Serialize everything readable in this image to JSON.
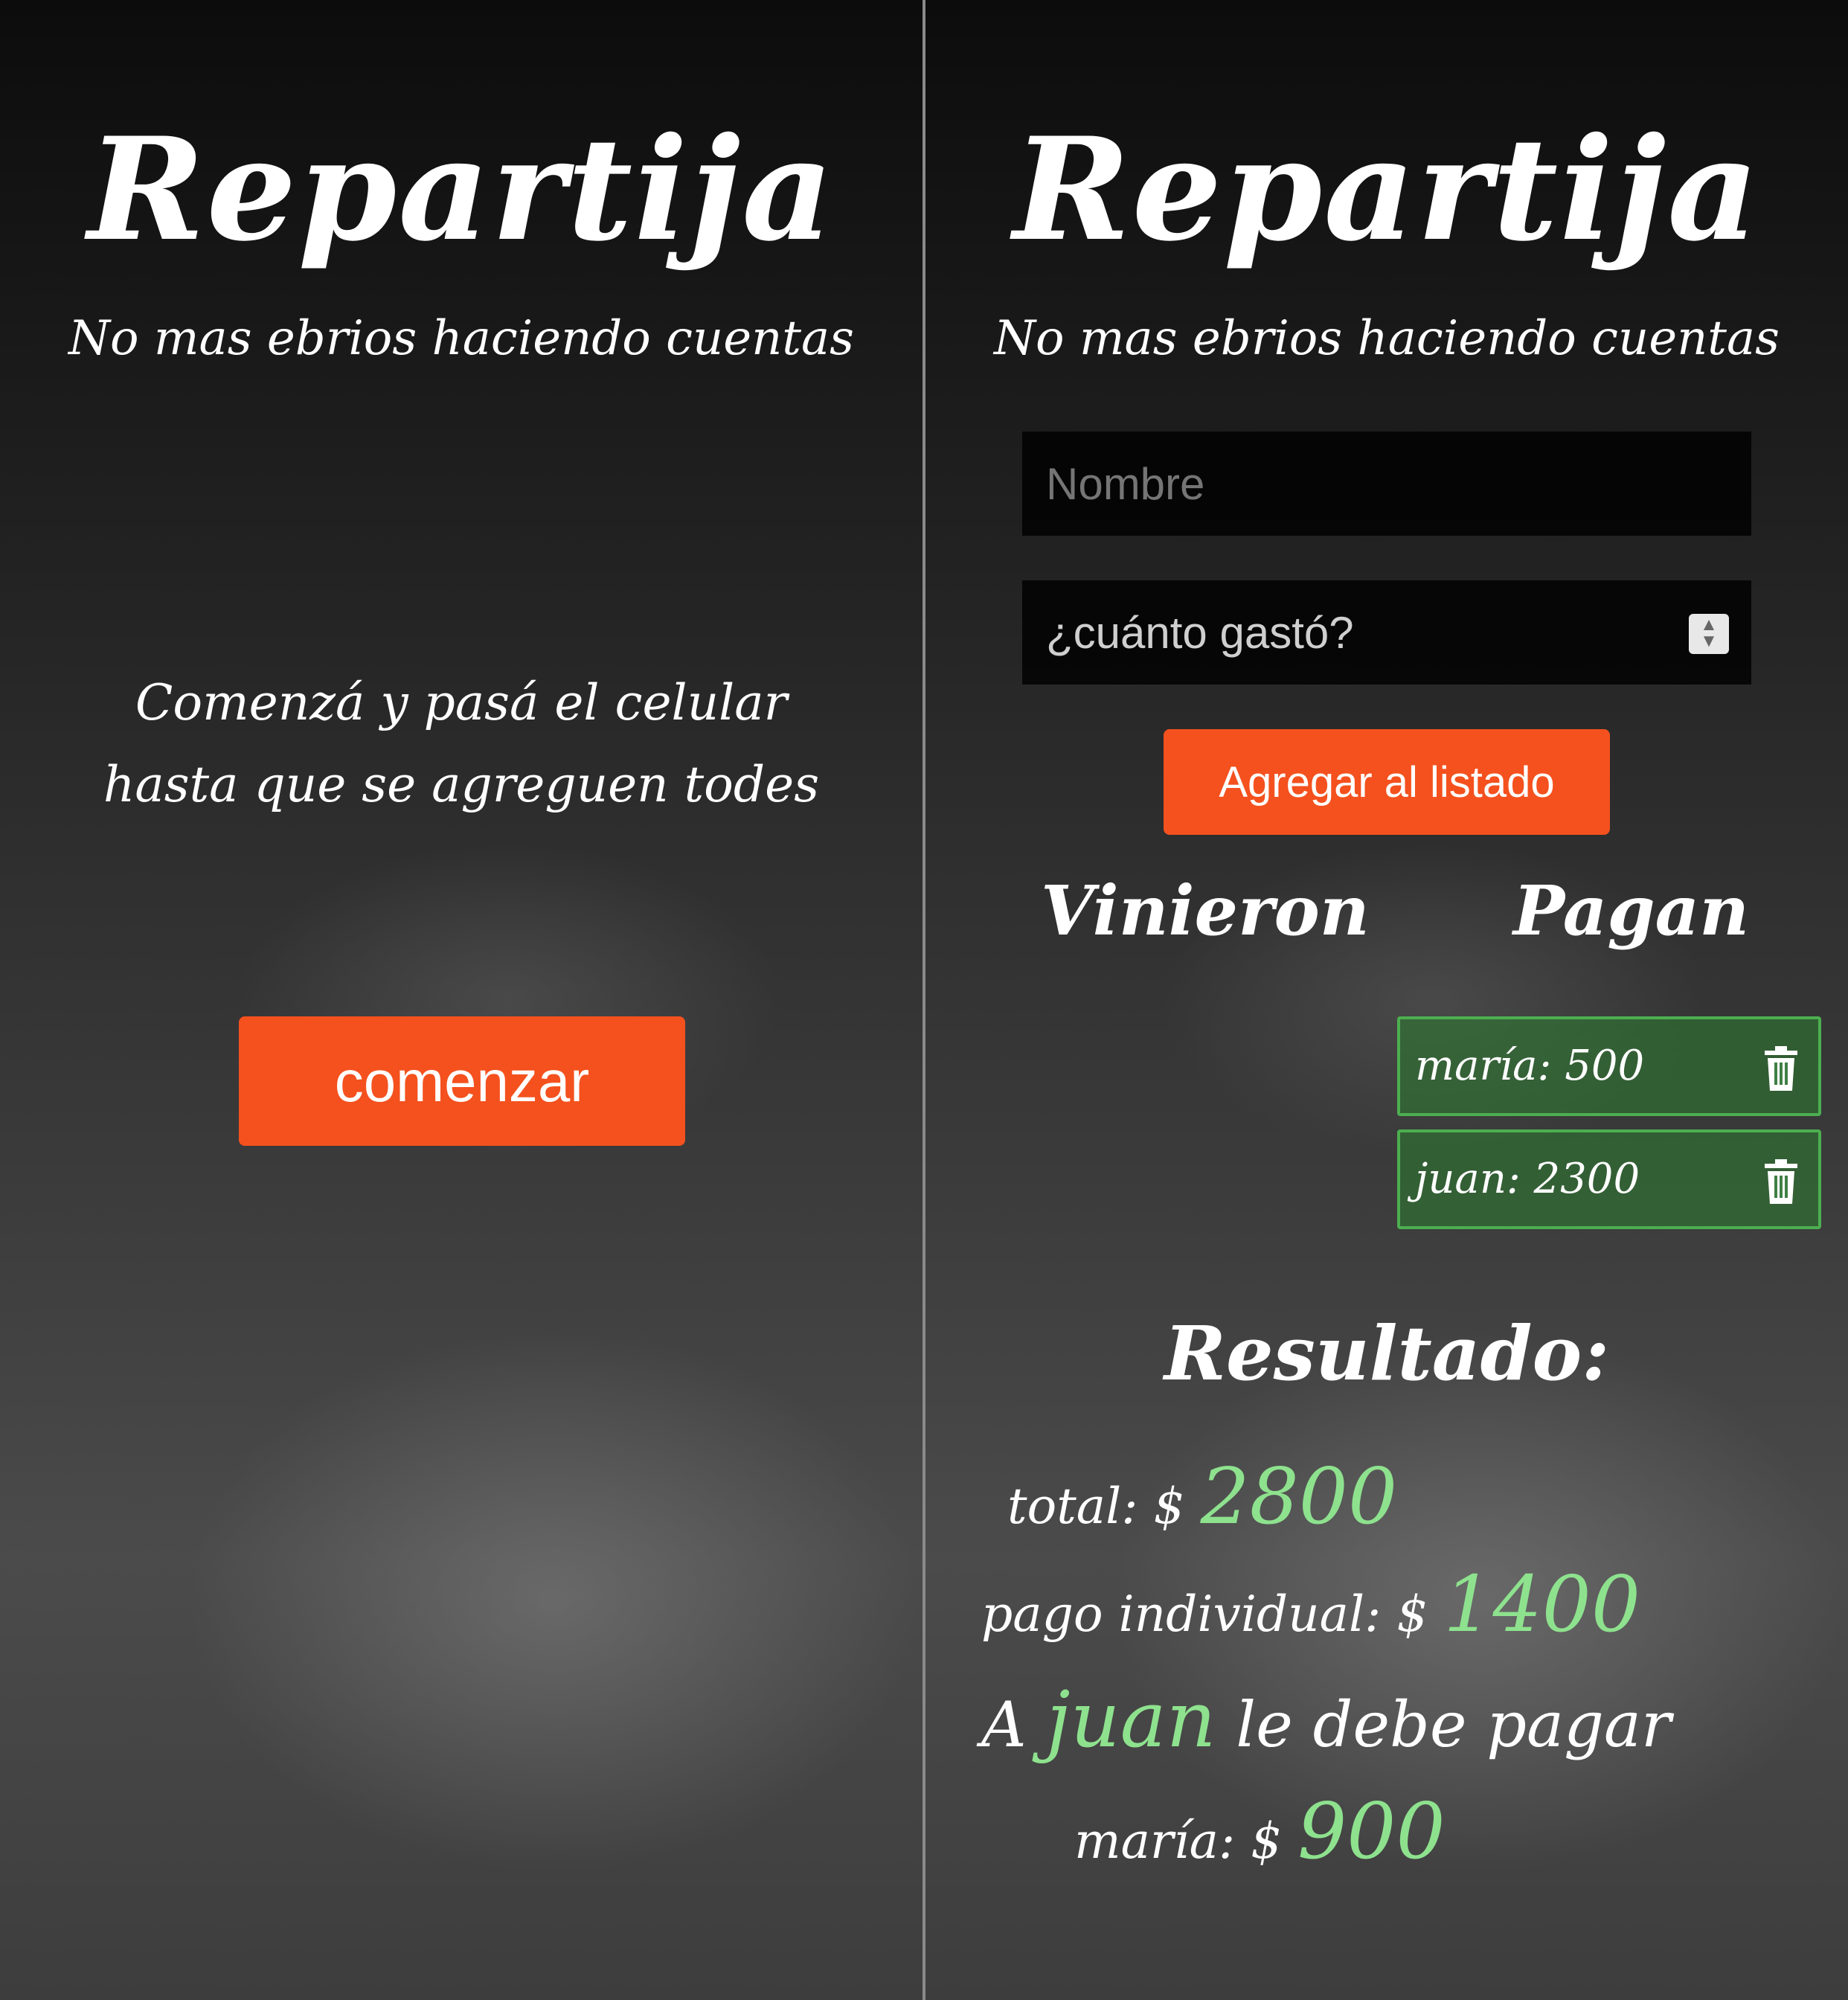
{
  "colors": {
    "accent_button": "#f4511e",
    "payer_item_bg": "#2e7d32",
    "payer_item_border": "#4caf50",
    "highlight_amount": "#8ee28e"
  },
  "left_screen": {
    "title": "Repartija",
    "subtitle": "No mas ebrios haciendo cuentas",
    "instructions_line1": "Comenzá y pasá el celular",
    "instructions_line2": "hasta que se agreguen todes",
    "start_button": "comenzar"
  },
  "right_screen": {
    "title": "Repartija",
    "subtitle": "No mas ebrios haciendo cuentas",
    "name_input": {
      "placeholder": "Nombre",
      "value": ""
    },
    "amount_input": {
      "placeholder": "¿cuánto gastó?",
      "value": ""
    },
    "add_button": "Agregar al listado",
    "columns": {
      "came": "Vinieron",
      "pay": "Pagan"
    },
    "payers": [
      {
        "label": "maría: 500",
        "icon": "trash-icon"
      },
      {
        "label": "juan: 2300",
        "icon": "trash-icon"
      }
    ],
    "result": {
      "heading": "Resultado:",
      "total_label": "total: $",
      "total_value": "2800",
      "individual_label": "pago individual: $",
      "individual_value": "1400",
      "debt_prefix": "A",
      "creditor": "juan",
      "debt_suffix": "le debe pagar",
      "debtor_label": "maría: $",
      "debtor_amount": "900"
    }
  }
}
